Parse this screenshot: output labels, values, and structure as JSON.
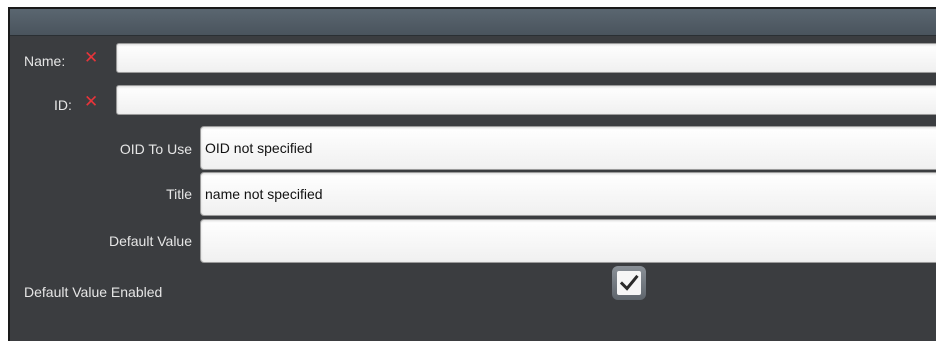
{
  "form": {
    "name": {
      "label": "Name:",
      "value": "",
      "error_icon": "x-mark-icon"
    },
    "id": {
      "label": "ID:",
      "value": "",
      "error_icon": "x-mark-icon"
    },
    "oid_to_use": {
      "label": "OID To Use",
      "value": "OID not specified"
    },
    "title": {
      "label": "Title",
      "value": "name not specified"
    },
    "default_value": {
      "label": "Default Value",
      "value": ""
    },
    "default_value_enabled": {
      "label": "Default Value Enabled",
      "checked": true
    }
  },
  "colors": {
    "background": "#3b3d40",
    "error": "#e8343a"
  }
}
